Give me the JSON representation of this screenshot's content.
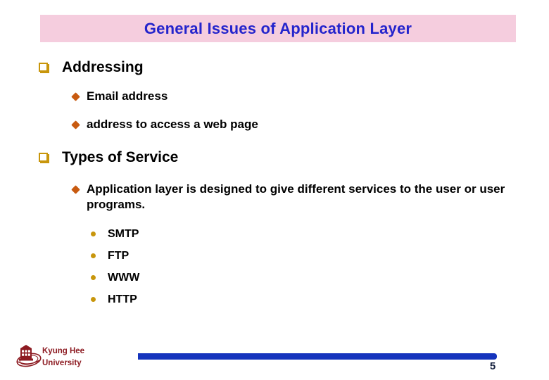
{
  "slide": {
    "title": "General Issues of Application Layer",
    "title_color": "#2424cc",
    "banner_color": "#f5cdde",
    "bullets": {
      "addressing": "Addressing",
      "email_address": "Email address",
      "web_address": "address to access a web page",
      "types_of_service": "Types of Service",
      "app_layer_desc": "Application layer is designed to give different services to the user or user programs.",
      "smtp": "SMTP",
      "ftp": "FTP",
      "www": "WWW",
      "http": "HTTP"
    },
    "bullet_icons": {
      "level1": "hollow-square-bullet",
      "level2": "diamond-bullet",
      "level3": "round-dot-bullet"
    },
    "bullet_colors": {
      "level1": "#c8960c",
      "level2": "#c85a10",
      "level3": "#c8960c"
    }
  },
  "footer": {
    "university_line1": "Kyung Hee",
    "university_line2": "University",
    "university_color": "#8d1b22",
    "logo_icon": "kyung-hee-university-crest-logo",
    "bar_color": "#1534bd",
    "page_number": "5"
  }
}
